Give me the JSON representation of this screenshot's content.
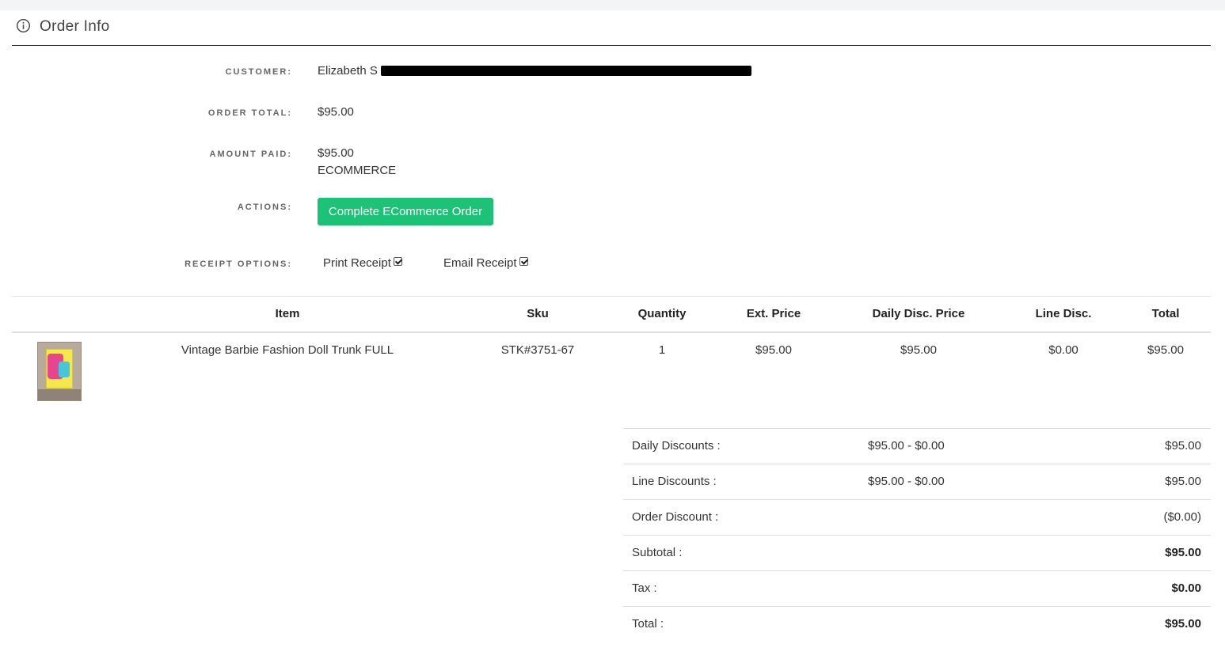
{
  "header": {
    "title": "Order Info",
    "icon": "info-icon"
  },
  "fields": {
    "customer_label": "CUSTOMER:",
    "customer_value": "Elizabeth S",
    "order_total_label": "ORDER TOTAL:",
    "order_total_value": "$95.00",
    "amount_paid_label": "AMOUNT PAID:",
    "amount_paid_value": "$95.00",
    "amount_paid_method": "ECOMMERCE",
    "actions_label": "ACTIONS:",
    "actions_button": "Complete ECommerce Order",
    "receipt_options_label": "RECEIPT OPTIONS:",
    "print_receipt": "Print Receipt",
    "email_receipt": "Email Receipt"
  },
  "table": {
    "columns": [
      "Item",
      "Sku",
      "Quantity",
      "Ext. Price",
      "Daily Disc. Price",
      "Line Disc.",
      "Total"
    ],
    "rows": [
      {
        "item": "Vintage Barbie Fashion Doll Trunk FULL",
        "sku": "STK#3751-67",
        "quantity": "1",
        "ext_price": "$95.00",
        "daily_disc_price": "$95.00",
        "line_disc": "$0.00",
        "total": "$95.00"
      }
    ]
  },
  "summary": [
    {
      "label": "Daily Discounts :",
      "detail": "$95.00 - $0.00",
      "value": "$95.00"
    },
    {
      "label": "Line Discounts :",
      "detail": "$95.00 - $0.00",
      "value": "$95.00"
    },
    {
      "label": "Order Discount :",
      "detail": "",
      "value": "($0.00)"
    },
    {
      "label": "Subtotal :",
      "detail": "",
      "value": "$95.00"
    },
    {
      "label": "Tax :",
      "detail": "",
      "value": "$0.00"
    },
    {
      "label": "Total :",
      "detail": "",
      "value": "$95.00"
    }
  ],
  "colors": {
    "accent": "#1cc275",
    "header_rule": "#333333"
  }
}
